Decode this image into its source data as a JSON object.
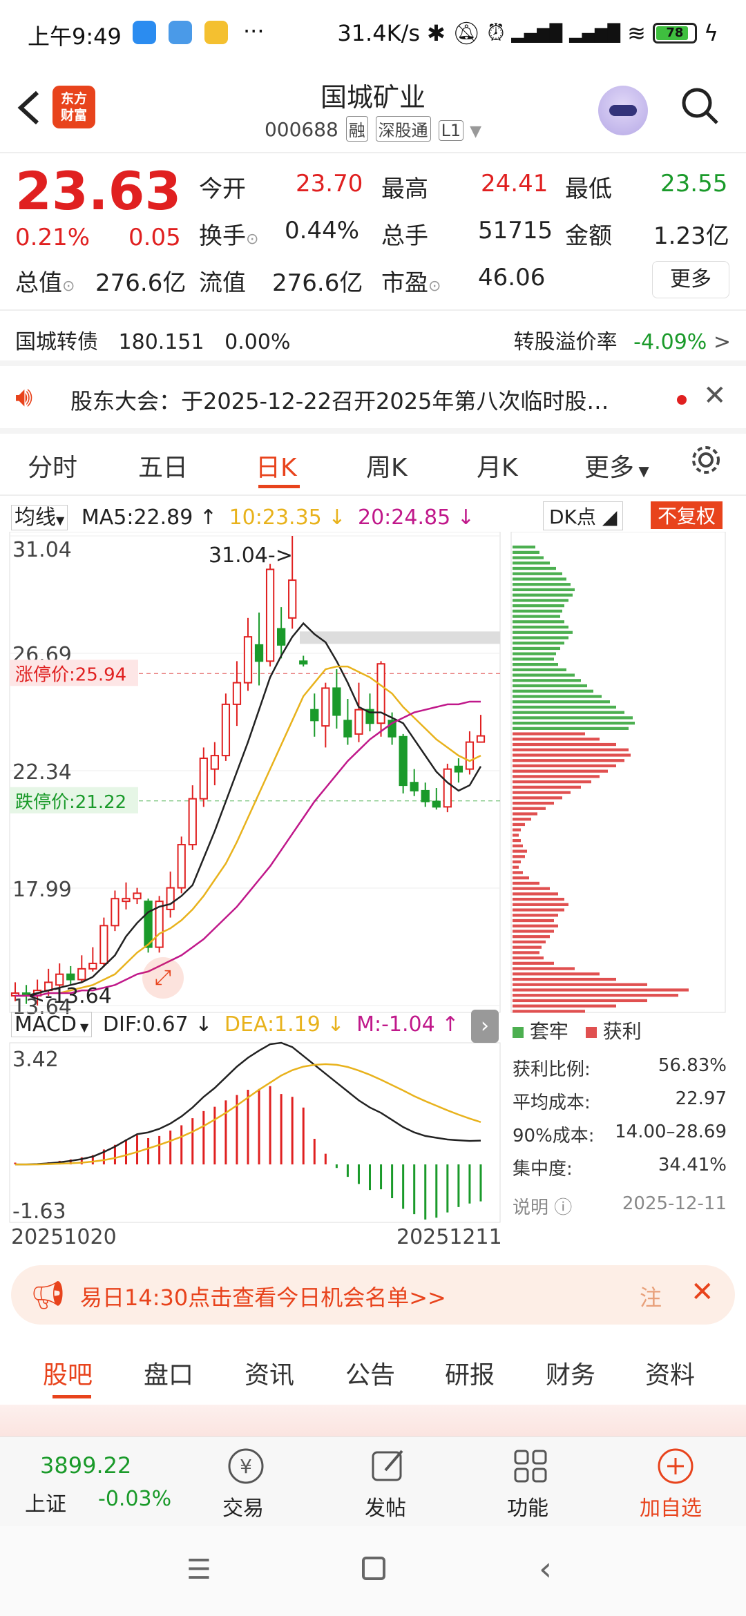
{
  "status": {
    "time": "上午9:49",
    "speed": "31.4K/s",
    "battery": "78"
  },
  "header": {
    "title": "国城矿业",
    "code": "000688",
    "tags": [
      "融",
      "深股通",
      "L1"
    ],
    "logo_line1": "东方",
    "logo_line2": "财富"
  },
  "quote": {
    "price": "23.63",
    "change_pct": "0.21%",
    "change": "0.05",
    "rows": [
      [
        {
          "k": "今开",
          "v": "23.70",
          "c": "red"
        },
        {
          "k": "最高",
          "v": "24.41",
          "c": "red"
        },
        {
          "k": "最低",
          "v": "23.55",
          "c": "green"
        }
      ],
      [
        {
          "k": "换手",
          "v": "0.44%",
          "c": ""
        },
        {
          "k": "总手",
          "v": "51715",
          "c": ""
        },
        {
          "k": "金额",
          "v": "1.23亿",
          "c": ""
        }
      ],
      [
        {
          "k": "总值",
          "v": "276.6亿",
          "c": ""
        },
        {
          "k": "流值",
          "v": "276.6亿",
          "c": ""
        },
        {
          "k": "市盈",
          "v": "46.06",
          "c": ""
        }
      ]
    ],
    "more_label": "更多",
    "bond": {
      "name": "国城转债",
      "price": "180.151",
      "pct": "0.00%",
      "premium_label": "转股溢价率",
      "premium": "-4.09%"
    }
  },
  "notice": {
    "text": "股东大会：于2025-12-22召开2025年第八次临时股…"
  },
  "period_tabs": [
    "分时",
    "五日",
    "日K",
    "周K",
    "月K",
    "更多"
  ],
  "active_tab": "日K",
  "chart_legend": {
    "ma_label": "均线",
    "ma5": "MA5:22.89",
    "ma10": "10:23.35",
    "ma20": "20:24.85",
    "dk": "DK点",
    "fq": "不复权"
  },
  "macd_legend": {
    "label": "MACD",
    "dif": "DIF:0.67",
    "dea": "DEA:1.19",
    "m": "M:-1.04"
  },
  "chart_data": [
    {
      "type": "candlestick",
      "title": "日K",
      "x_start": "20251020",
      "x_end": "20251211",
      "y_ticks": [
        "31.04",
        "26.69",
        "22.34",
        "17.99",
        "13.64"
      ],
      "ylim": [
        13.64,
        31.04
      ],
      "limit_up": "涨停价:25.94",
      "limit_down": "跌停价:21.22",
      "high_marker": "31.04->",
      "low_marker": "<-13.64",
      "candles": [
        {
          "o": 14.0,
          "c": 14.1,
          "h": 14.5,
          "l": 13.8
        },
        {
          "o": 14.1,
          "c": 14.0,
          "h": 14.4,
          "l": 13.7
        },
        {
          "o": 14.0,
          "c": 14.2,
          "h": 14.6,
          "l": 13.64
        },
        {
          "o": 14.2,
          "c": 14.5,
          "h": 15.0,
          "l": 14.0
        },
        {
          "o": 14.4,
          "c": 14.8,
          "h": 15.2,
          "l": 14.3
        },
        {
          "o": 14.8,
          "c": 14.6,
          "h": 15.1,
          "l": 14.4
        },
        {
          "o": 14.6,
          "c": 15.0,
          "h": 15.5,
          "l": 14.5
        },
        {
          "o": 15.0,
          "c": 15.2,
          "h": 15.8,
          "l": 14.9
        },
        {
          "o": 15.2,
          "c": 16.6,
          "h": 16.9,
          "l": 15.1
        },
        {
          "o": 16.6,
          "c": 17.6,
          "h": 17.9,
          "l": 16.4
        },
        {
          "o": 17.5,
          "c": 17.6,
          "h": 18.2,
          "l": 17.2
        },
        {
          "o": 17.6,
          "c": 17.8,
          "h": 18.0,
          "l": 17.4
        },
        {
          "o": 17.5,
          "c": 15.8,
          "h": 17.6,
          "l": 15.6
        },
        {
          "o": 15.8,
          "c": 17.5,
          "h": 17.7,
          "l": 15.6
        },
        {
          "o": 17.2,
          "c": 18.0,
          "h": 18.6,
          "l": 16.9
        },
        {
          "o": 18.0,
          "c": 19.6,
          "h": 19.9,
          "l": 17.8
        },
        {
          "o": 19.6,
          "c": 21.3,
          "h": 21.8,
          "l": 19.4
        },
        {
          "o": 21.3,
          "c": 22.8,
          "h": 23.2,
          "l": 21.0
        },
        {
          "o": 22.4,
          "c": 22.9,
          "h": 23.4,
          "l": 21.8
        },
        {
          "o": 22.9,
          "c": 24.8,
          "h": 25.2,
          "l": 22.7
        },
        {
          "o": 24.8,
          "c": 25.6,
          "h": 26.4,
          "l": 24.0
        },
        {
          "o": 25.6,
          "c": 27.3,
          "h": 28.0,
          "l": 25.3
        },
        {
          "o": 27.0,
          "c": 26.4,
          "h": 28.2,
          "l": 25.5
        },
        {
          "o": 26.4,
          "c": 29.8,
          "h": 30.0,
          "l": 26.2
        },
        {
          "o": 27.6,
          "c": 27.0,
          "h": 28.4,
          "l": 26.5
        },
        {
          "o": 28.0,
          "c": 29.4,
          "h": 31.04,
          "l": 27.6
        },
        {
          "o": 26.4,
          "c": 26.3,
          "h": 26.6,
          "l": 26.2
        },
        {
          "o": 24.6,
          "c": 24.2,
          "h": 25.2,
          "l": 23.6
        },
        {
          "o": 24.0,
          "c": 25.4,
          "h": 25.6,
          "l": 23.2
        },
        {
          "o": 25.4,
          "c": 24.4,
          "h": 26.1,
          "l": 23.9
        },
        {
          "o": 24.2,
          "c": 23.6,
          "h": 25.0,
          "l": 23.3
        },
        {
          "o": 23.7,
          "c": 24.6,
          "h": 25.6,
          "l": 23.4
        },
        {
          "o": 24.6,
          "c": 24.1,
          "h": 25.2,
          "l": 23.8
        },
        {
          "o": 24.1,
          "c": 26.3,
          "h": 26.4,
          "l": 23.6
        },
        {
          "o": 24.2,
          "c": 23.6,
          "h": 24.5,
          "l": 23.3
        },
        {
          "o": 23.6,
          "c": 21.8,
          "h": 23.7,
          "l": 21.5
        },
        {
          "o": 21.9,
          "c": 21.6,
          "h": 22.4,
          "l": 21.4
        },
        {
          "o": 21.6,
          "c": 21.2,
          "h": 21.9,
          "l": 21.0
        },
        {
          "o": 21.2,
          "c": 21.0,
          "h": 21.7,
          "l": 20.9
        },
        {
          "o": 21.0,
          "c": 22.4,
          "h": 22.6,
          "l": 20.8
        },
        {
          "o": 22.5,
          "c": 22.3,
          "h": 22.8,
          "l": 21.9
        },
        {
          "o": 22.4,
          "c": 23.4,
          "h": 23.8,
          "l": 22.2
        },
        {
          "o": 23.4,
          "c": 23.63,
          "h": 24.41,
          "l": 23.55
        }
      ],
      "ma5": [
        14.0,
        14.0,
        14.1,
        14.2,
        14.3,
        14.4,
        14.5,
        14.7,
        15.1,
        15.5,
        16.2,
        16.7,
        17.1,
        17.3,
        17.4,
        17.7,
        18.1,
        19.1,
        20.1,
        21.2,
        22.3,
        23.4,
        24.6,
        25.8,
        26.6,
        27.3,
        27.8,
        27.4,
        27.1,
        26.4,
        25.6,
        24.7,
        24.5,
        24.5,
        24.3,
        24.1,
        23.5,
        22.9,
        22.3,
        21.9,
        21.6,
        21.8,
        22.5
      ],
      "ma10": [
        14.0,
        14.0,
        14.0,
        14.1,
        14.1,
        14.2,
        14.3,
        14.4,
        14.6,
        14.8,
        15.2,
        15.6,
        15.9,
        16.3,
        16.5,
        16.8,
        17.2,
        17.7,
        18.3,
        18.9,
        19.7,
        20.6,
        21.5,
        22.4,
        23.3,
        24.2,
        25.1,
        25.6,
        26.1,
        26.2,
        26.2,
        26.0,
        25.8,
        25.5,
        25.2,
        24.7,
        24.3,
        23.9,
        23.5,
        23.2,
        22.9,
        22.7,
        22.9
      ],
      "ma20": [
        14.0,
        14.0,
        14.0,
        14.1,
        14.1,
        14.1,
        14.2,
        14.2,
        14.3,
        14.4,
        14.6,
        14.8,
        14.9,
        15.1,
        15.3,
        15.5,
        15.8,
        16.1,
        16.5,
        16.9,
        17.3,
        17.8,
        18.3,
        18.8,
        19.4,
        20.0,
        20.6,
        21.2,
        21.7,
        22.2,
        22.7,
        23.1,
        23.5,
        23.8,
        24.1,
        24.3,
        24.5,
        24.6,
        24.7,
        24.8,
        24.8,
        24.9,
        24.9
      ]
    },
    {
      "type": "bar",
      "title": "MACD",
      "y_ticks": [
        "3.42",
        "-1.63"
      ],
      "ylim": [
        -1.63,
        3.42
      ],
      "m": [
        0.05,
        0.02,
        0.03,
        0.06,
        0.1,
        0.14,
        0.2,
        0.26,
        0.42,
        0.55,
        0.7,
        0.82,
        0.74,
        0.8,
        0.95,
        1.1,
        1.3,
        1.5,
        1.62,
        1.8,
        1.95,
        2.1,
        2.12,
        2.2,
        1.98,
        1.9,
        1.6,
        0.72,
        0.3,
        -0.1,
        -0.35,
        -0.55,
        -0.72,
        -0.7,
        -0.95,
        -1.25,
        -1.4,
        -1.55,
        -1.5,
        -1.35,
        -1.2,
        -1.1,
        -1.04
      ],
      "dif": [
        0.0,
        0.0,
        0.01,
        0.03,
        0.06,
        0.1,
        0.15,
        0.22,
        0.35,
        0.5,
        0.68,
        0.85,
        0.9,
        1.0,
        1.15,
        1.35,
        1.6,
        1.9,
        2.15,
        2.45,
        2.75,
        3.0,
        3.2,
        3.38,
        3.42,
        3.3,
        3.05,
        2.8,
        2.55,
        2.3,
        2.05,
        1.8,
        1.6,
        1.45,
        1.25,
        1.05,
        0.9,
        0.8,
        0.75,
        0.7,
        0.68,
        0.66,
        0.67
      ],
      "dea": [
        0.0,
        0.0,
        0.0,
        0.01,
        0.02,
        0.03,
        0.05,
        0.08,
        0.12,
        0.18,
        0.26,
        0.35,
        0.45,
        0.55,
        0.66,
        0.78,
        0.92,
        1.08,
        1.26,
        1.45,
        1.66,
        1.88,
        2.1,
        2.3,
        2.5,
        2.65,
        2.75,
        2.8,
        2.82,
        2.8,
        2.74,
        2.64,
        2.52,
        2.38,
        2.23,
        2.08,
        1.92,
        1.78,
        1.65,
        1.52,
        1.4,
        1.29,
        1.19
      ]
    },
    {
      "type": "bar",
      "title": "筹码分布",
      "bars_green": [
        22,
        26,
        30,
        36,
        42,
        48,
        52,
        56,
        60,
        58,
        54,
        50,
        48,
        46,
        50,
        54,
        58,
        54,
        50,
        46,
        42,
        40,
        44,
        52,
        60,
        66,
        72,
        78,
        86,
        94,
        100,
        108,
        116,
        118,
        112
      ],
      "bars_red": [
        70,
        84,
        100,
        112,
        114,
        108,
        100,
        92,
        84,
        76,
        66,
        56,
        48,
        40,
        32,
        24,
        18,
        12,
        8,
        6,
        8,
        10,
        14,
        12,
        8,
        6,
        10,
        16,
        26,
        36,
        44,
        50,
        54,
        50,
        44,
        40,
        44,
        40,
        36,
        32,
        28,
        26,
        30,
        40,
        60,
        84,
        100,
        130,
        170,
        160,
        130,
        100,
        70
      ]
    }
  ],
  "chip_panel": {
    "legend_trap": "套牢",
    "legend_profit": "获利",
    "stats": [
      {
        "k": "获利比例:",
        "v": "56.83%"
      },
      {
        "k": "平均成本:",
        "v": "22.97"
      },
      {
        "k": "90%成本:",
        "v": "14.00–28.69"
      },
      {
        "k": "集中度:",
        "v": "34.41%"
      }
    ],
    "note_label": "说明",
    "date": "2025-12-11"
  },
  "ad_banner": {
    "text": "易日14:30点击查看今日机会名单>>",
    "tail": "注"
  },
  "section_tabs": [
    "股吧",
    "盘口",
    "资讯",
    "公告",
    "研报",
    "财务",
    "资料"
  ],
  "index_info": {
    "value": "3899.22",
    "name": "上证",
    "pct": "-0.03%"
  },
  "bottom_nav": [
    "交易",
    "发帖",
    "功能",
    "加自选"
  ]
}
